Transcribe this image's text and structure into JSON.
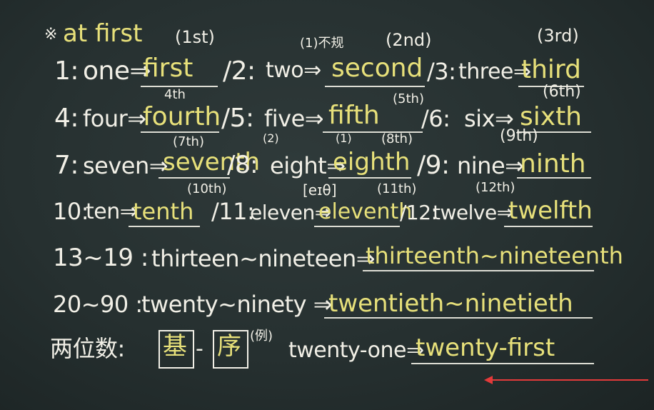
{
  "header": {
    "mark": "※",
    "title": "at first",
    "title_note": "(1st)"
  },
  "rows": {
    "r1": {
      "a_num": "1:",
      "a_word": "one⇒",
      "a_ans": "first",
      "b_num": "/2:",
      "b_word": "two⇒",
      "b_ans": "second",
      "b_note_top": "(1)不规",
      "b_note": "(2nd)",
      "c_num": "/3:",
      "c_word": "three⇒",
      "c_ans": "third",
      "c_note": "(3rd)"
    },
    "r2": {
      "a_num": "4:",
      "a_word": "four⇒",
      "a_ans": "fourth",
      "a_note": "4th",
      "b_num": "/5:",
      "b_word": "five⇒",
      "b_ans": "fifth",
      "b_note": "(5th)",
      "c_num": "/6:",
      "c_word": "six⇒",
      "c_ans": "sixth",
      "c_note": "(6th)"
    },
    "r3": {
      "a_num": "7:",
      "a_word": "seven⇒",
      "a_ans": "seventh",
      "a_note": "(7th)",
      "b_num": "/8:",
      "b_word": "eight⇒",
      "b_ans": "eighth",
      "b_note": "(8th)",
      "b_note_left": "(2)",
      "b_note_mid": "(1)",
      "c_num": "/9:",
      "c_word": "nine⇒",
      "c_ans": "ninth",
      "c_note": "(9th)"
    },
    "r4": {
      "a_num": "10:",
      "a_word": "ten⇒",
      "a_ans": "tenth",
      "a_note": "(10th)",
      "b_num": "/11:",
      "b_word": "eleven⇒",
      "b_ans": "eleventh",
      "b_note": "(11th)",
      "b_phon": "[eɪθ]",
      "c_num": "/12:",
      "c_word": "twelve⇒",
      "c_ans": "twelfth",
      "c_note": "(12th)"
    },
    "r5": {
      "num": "13~19 :",
      "word": "thirteen~nineteen⇒",
      "ans": "thirteenth~nineteenth"
    },
    "r6": {
      "num": "20~90 :",
      "word": "twenty~ninety ⇒",
      "ans": "twentieth~ninetieth"
    },
    "r7": {
      "label": "两位数:",
      "box1": "基",
      "dash": "-",
      "box2": "序",
      "eg": "(例)",
      "word": "twenty-one⇒",
      "ans": "twenty-first"
    }
  },
  "colors": {
    "chalk_white": "#f1efe6",
    "chalk_yellow": "#e7e07a",
    "pointer_red": "#e33a3a",
    "board": "#2a3434"
  },
  "icons": {
    "pointer": "red-pointer-arrow-icon"
  }
}
